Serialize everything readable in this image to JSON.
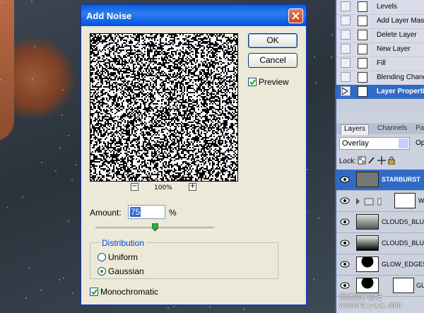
{
  "dialog": {
    "title": "Add Noise",
    "ok_label": "OK",
    "cancel_label": "Cancel",
    "preview_label": "Preview",
    "preview_checked": true,
    "zoom_out_glyph": "−",
    "zoom_in_glyph": "+",
    "zoom_level": "100%",
    "amount_label": "Amount:",
    "amount_value": "75",
    "amount_unit": "%",
    "amount_slider_fraction": 0.5,
    "distribution_label": "Distribution",
    "uniform_label": "Uniform",
    "gaussian_label": "Gaussian",
    "selected_distribution": "Gaussian",
    "monochromatic_label": "Monochromatic",
    "monochromatic_checked": true
  },
  "history": {
    "items": [
      {
        "label": "Levels",
        "selected": false
      },
      {
        "label": "Add Layer Mask",
        "selected": false
      },
      {
        "label": "Delete Layer",
        "selected": false
      },
      {
        "label": "New Layer",
        "selected": false
      },
      {
        "label": "Fill",
        "selected": false
      },
      {
        "label": "Blending Change",
        "selected": false
      },
      {
        "label": "Layer Properties",
        "selected": true
      }
    ]
  },
  "layers": {
    "tabs": [
      "Layers",
      "Channels",
      "Paths"
    ],
    "blend_mode": "Overlay",
    "opacity_label": "Opacity",
    "lock_label": "Lock:",
    "rows": [
      {
        "name": "STARBURST",
        "selected": true
      },
      {
        "name": "WATER",
        "selected": false
      },
      {
        "name": "CLOUDS_BLUR",
        "selected": false
      },
      {
        "name": "CLOUDS_BLUR",
        "selected": false
      },
      {
        "name": "GLOW_EDGES",
        "selected": false
      },
      {
        "name": "GLOW",
        "selected": false
      }
    ]
  },
  "watermark": {
    "line1": "思缘设计论坛 www.missyuan.com",
    "line2": "UiBQ.CoM"
  },
  "colors": {
    "title_bar": "#0a5fd6",
    "dialog_bg": "#ece9d8",
    "selection": "#316ac5",
    "distribution_text": "#0046d5"
  }
}
